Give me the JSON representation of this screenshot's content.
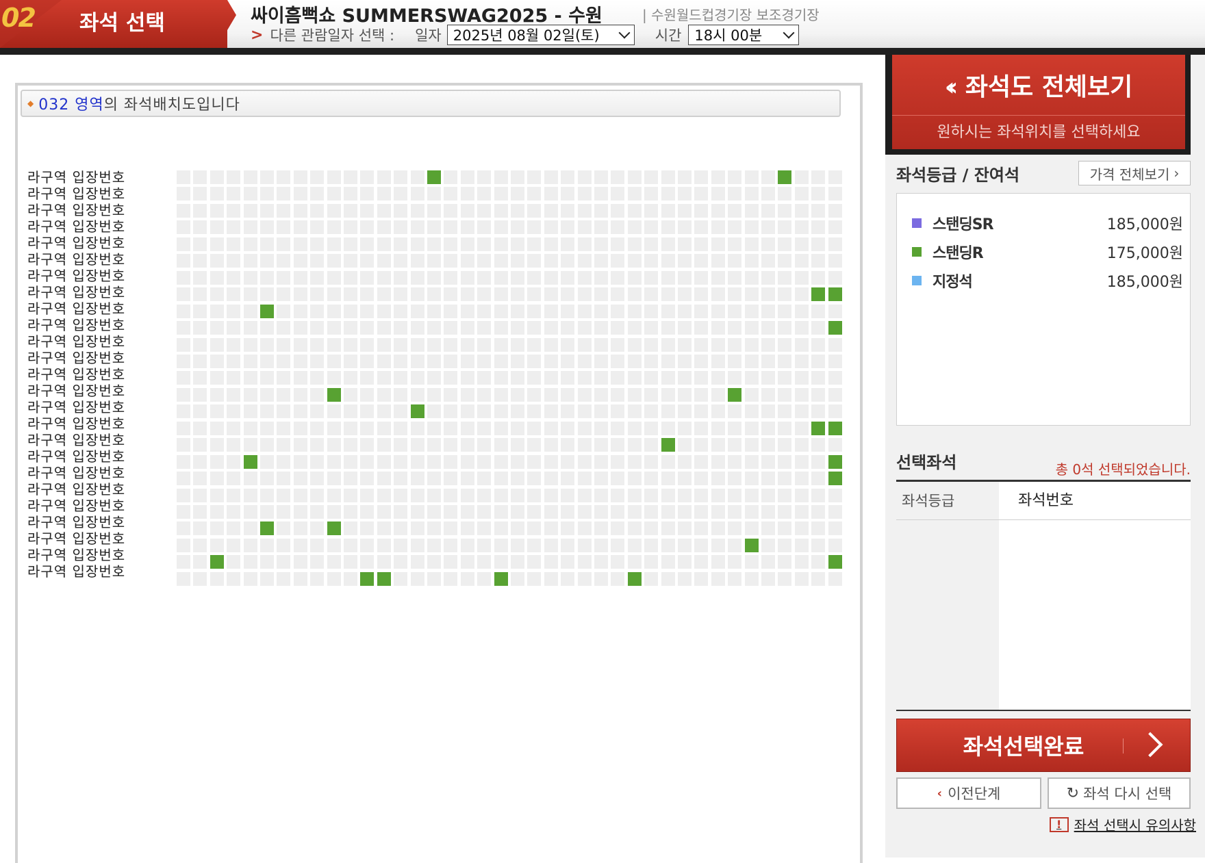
{
  "header": {
    "step_number": "02",
    "step_label": "좌석 선택",
    "show_title": "싸이흠뻑쇼 SUMMERSWAG2025 - 수원",
    "venue": "| 수원월드컵경기장 보조경기장",
    "date_prompt": "다른 관람일자 선택 :",
    "date_label": "일자",
    "date_value": "2025년 08월 02일(토)",
    "time_label": "시간",
    "time_value": "18시 00분"
  },
  "seatmap": {
    "title_zone": "032 영역",
    "title_suffix": "의 좌석배치도입니다",
    "row_labels": [
      "라구역 입장번호",
      "라구역 입장번호",
      "라구역 입장번호",
      "라구역 입장번호",
      "라구역 입장번호",
      "라구역 입장번호",
      "라구역 입장번호",
      "라구역 입장번호",
      "라구역 입장번호",
      "라구역 입장번호",
      "라구역 입장번호",
      "라구역 입장번호",
      "라구역 입장번호",
      "라구역 입장번호",
      "라구역 입장번호",
      "라구역 입장번호",
      "라구역 입장번호",
      "라구역 입장번호",
      "라구역 입장번호",
      "라구역 입장번호",
      "라구역 입장번호",
      "라구역 입장번호",
      "라구역 입장번호",
      "라구역 입장번호",
      "라구역 입장번호"
    ],
    "columns": 40,
    "available_color": "#58a232",
    "unavailable_color": "#eeeeee",
    "available_seats": [
      [
        0,
        15
      ],
      [
        0,
        36
      ],
      [
        7,
        38
      ],
      [
        7,
        39
      ],
      [
        8,
        5
      ],
      [
        9,
        39
      ],
      [
        13,
        9
      ],
      [
        13,
        33
      ],
      [
        14,
        14
      ],
      [
        15,
        38
      ],
      [
        15,
        39
      ],
      [
        16,
        29
      ],
      [
        17,
        4
      ],
      [
        17,
        39
      ],
      [
        18,
        39
      ],
      [
        21,
        5
      ],
      [
        21,
        9
      ],
      [
        22,
        34
      ],
      [
        23,
        2
      ],
      [
        23,
        39
      ],
      [
        24,
        11
      ],
      [
        24,
        12
      ],
      [
        24,
        19
      ],
      [
        24,
        27
      ]
    ]
  },
  "right": {
    "view_all_title": "좌석도 전체보기",
    "view_all_sub": "원하시는 좌석위치를 선택하세요",
    "grade_head": "좌석등급 / 잔여석",
    "price_all_btn": "가격 전체보기",
    "grades": [
      {
        "name": "스탠딩SR",
        "price": "185,000원",
        "color": "#7b6be0"
      },
      {
        "name": "스탠딩R",
        "price": "175,000원",
        "color": "#58a232"
      },
      {
        "name": "지정석",
        "price": "185,000원",
        "color": "#6cb4f0"
      }
    ],
    "selected_head": "선택좌석",
    "selected_count": "총 0석 선택되었습니다.",
    "th_grade": "좌석등급",
    "th_number": "좌석번호",
    "complete_btn": "좌석선택완료",
    "prev_btn": "이전단계",
    "reselect_btn": "좌석 다시 선택",
    "notice_link": "좌석 선택시 유의사항"
  }
}
